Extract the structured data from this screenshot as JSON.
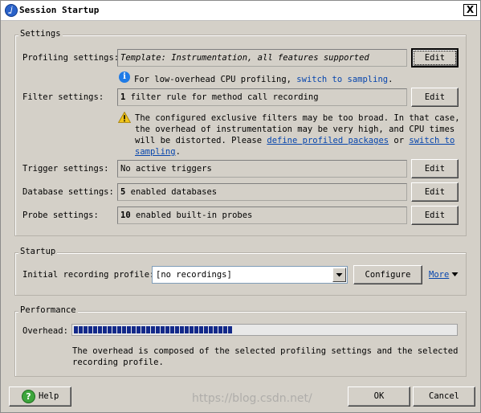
{
  "window": {
    "title": "Session Startup",
    "close_label": "X"
  },
  "settings": {
    "group_title": "Settings",
    "profiling": {
      "label": "Profiling settings:",
      "value": "Template: Instrumentation, all features supported",
      "button": "Edit"
    },
    "info_text": "For low-overhead CPU profiling, ",
    "info_link": "switch to sampling",
    "info_end": ".",
    "filter": {
      "label": "Filter settings:",
      "count": "1",
      "value": " filter rule for method call recording",
      "button": "Edit"
    },
    "warning": {
      "line1": "The configured exclusive filters may be too broad. In that case,",
      "line2": "the overhead of instrumentation may be very high, and CPU times",
      "line3_pre": "will be distorted. Please ",
      "line3_link": "define profiled packages",
      "line3_mid": " or ",
      "line3_link2": "switch to",
      "line4_link": "sampling",
      "line4_end": "."
    },
    "trigger": {
      "label": "Trigger settings:",
      "value": "No active triggers",
      "button": "Edit"
    },
    "database": {
      "label": "Database settings:",
      "count": "5",
      "value": " enabled databases",
      "button": "Edit"
    },
    "probe": {
      "label": "Probe settings:",
      "count": "10",
      "value": " enabled built-in probes",
      "button": "Edit"
    }
  },
  "startup": {
    "group_title": "Startup",
    "label": "Initial recording profile:",
    "selected": "[no recordings]",
    "configure_button": "Configure",
    "more_link": "More"
  },
  "performance": {
    "group_title": "Performance",
    "overhead_label": "Overhead:",
    "overhead_fraction": 0.42,
    "description_line1": "The overhead is composed of the selected profiling settings and the selected",
    "description_line2": "recording profile."
  },
  "footer": {
    "help_button": "Help",
    "ok_button": "OK",
    "cancel_button": "Cancel",
    "watermark": "https://blog.csdn.net/"
  }
}
